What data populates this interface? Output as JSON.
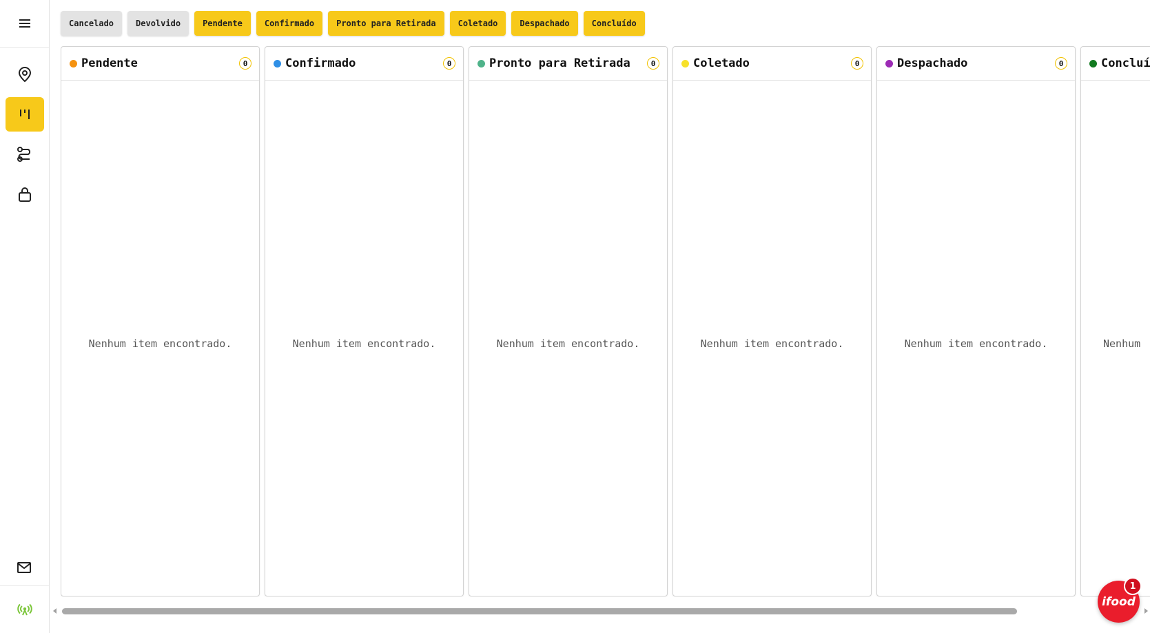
{
  "sidebar": {
    "items": [
      {
        "icon": "menu-icon"
      },
      {
        "icon": "location-pin-icon"
      },
      {
        "icon": "kanban-board-icon",
        "active": true
      },
      {
        "icon": "route-icon"
      },
      {
        "icon": "lock-icon"
      },
      {
        "icon": "mail-icon"
      },
      {
        "icon": "broadcast-icon"
      }
    ]
  },
  "filters": [
    "Cancelado",
    "Devolvido",
    "Pendente",
    "Confirmado",
    "Pronto para Retirada",
    "Coletado",
    "Despachado",
    "Concluído"
  ],
  "columns": [
    {
      "title": "Pendente",
      "count": "0",
      "empty": "Nenhum item encontrado.",
      "color": "#f5920f"
    },
    {
      "title": "Confirmado",
      "count": "0",
      "empty": "Nenhum item encontrado.",
      "color": "#2f8fe6"
    },
    {
      "title": "Pronto para Retirada",
      "count": "0",
      "empty": "Nenhum item encontrado.",
      "color": "#4fb38a"
    },
    {
      "title": "Coletado",
      "count": "0",
      "empty": "Nenhum item encontrado.",
      "color": "#f7e12a"
    },
    {
      "title": "Despachado",
      "count": "0",
      "empty": "Nenhum item encontrado.",
      "color": "#9c2bb5"
    },
    {
      "title": "Concluí",
      "count": "",
      "empty": "Nenhum",
      "color": "#117a1f"
    }
  ],
  "colors": {
    "accent": "#f7c91a",
    "chip_grey": "#e3e3e3",
    "online": "#7cc63b",
    "ifood": "#ea1d2c"
  },
  "ifood": {
    "logo": "ifood",
    "badge": "1"
  }
}
